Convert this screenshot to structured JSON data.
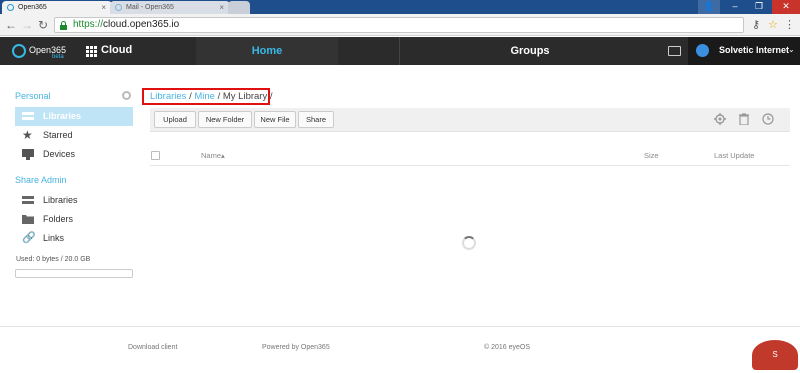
{
  "browser": {
    "tabs": [
      {
        "label": "Open365",
        "active": true
      },
      {
        "label": "Mail - Open365",
        "active": false
      }
    ],
    "url_scheme": "https://",
    "url_host": "cloud.open365.io"
  },
  "app": {
    "logo_text": "Open365",
    "logo_badge": "beta",
    "section_title": "Cloud",
    "nav": {
      "home": "Home",
      "groups": "Groups"
    },
    "user_name": "Solvetic Internet",
    "accent_color": "#37b8e6"
  },
  "sidebar": {
    "personal_title": "Personal",
    "personal_items": [
      {
        "label": "Libraries",
        "icon": "library-icon",
        "active": true
      },
      {
        "label": "Starred",
        "icon": "star-icon",
        "active": false
      },
      {
        "label": "Devices",
        "icon": "monitor-icon",
        "active": false
      }
    ],
    "share_title": "Share Admin",
    "share_items": [
      {
        "label": "Libraries",
        "icon": "library-icon"
      },
      {
        "label": "Folders",
        "icon": "folder-icon"
      },
      {
        "label": "Links",
        "icon": "link-icon"
      }
    ],
    "usage": "Used: 0 bytes / 20.0 GB",
    "usage_fraction": 0
  },
  "breadcrumb": {
    "libraries": "Libraries",
    "mine": "Mine",
    "current": "My Library",
    "sep": " / "
  },
  "toolbar": {
    "upload": "Upload",
    "new_folder": "New Folder",
    "new_file": "New File",
    "share": "Share"
  },
  "table": {
    "col_name": "Name",
    "sort_indicator": "▴",
    "col_size": "Size",
    "col_updated": "Last Update"
  },
  "footer": {
    "download": "Download client",
    "powered": "Powered by Open365",
    "copyright": "© 2016 eyeOS"
  }
}
